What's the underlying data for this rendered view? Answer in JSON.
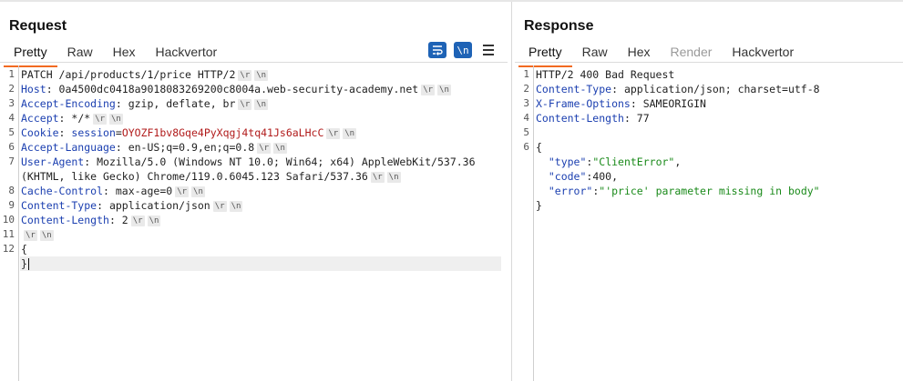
{
  "request": {
    "title": "Request",
    "tabs": [
      "Pretty",
      "Raw",
      "Hex",
      "Hackvertor"
    ],
    "tools": {
      "wrap_icon": "wrap-lines-icon",
      "newline_label": "\\n",
      "menu_icon": "hamburger-menu-icon"
    },
    "lines": [
      {
        "n": "1",
        "parts": [
          {
            "t": "PATCH /api/products/1/price HTTP/2",
            "c": ""
          }
        ],
        "crlf": true
      },
      {
        "n": "2",
        "parts": [
          {
            "t": "Host",
            "c": "hk"
          },
          {
            "t": ": 0a4500dc0418a9018083269200c8004a.web-security-academy.net",
            "c": ""
          }
        ],
        "crlf": true
      },
      {
        "n": "3",
        "parts": [
          {
            "t": "Accept-Encoding",
            "c": "hk"
          },
          {
            "t": ": gzip, deflate, br",
            "c": ""
          }
        ],
        "crlf": true
      },
      {
        "n": "4",
        "parts": [
          {
            "t": "Accept",
            "c": "hk"
          },
          {
            "t": ": */*",
            "c": ""
          }
        ],
        "crlf": true
      },
      {
        "n": "5",
        "parts": [
          {
            "t": "Cookie",
            "c": "hk"
          },
          {
            "t": ": ",
            "c": ""
          },
          {
            "t": "session",
            "c": "hk"
          },
          {
            "t": "=",
            "c": ""
          },
          {
            "t": "OYOZF1bv8Gqe4PyXqgj4tq41Js6aLHcC",
            "c": "cookie"
          }
        ],
        "crlf": true
      },
      {
        "n": "6",
        "parts": [
          {
            "t": "Accept-Language",
            "c": "hk"
          },
          {
            "t": ": en-US;q=0.9,en;q=0.8",
            "c": ""
          }
        ],
        "crlf": true
      },
      {
        "n": "7",
        "parts": [
          {
            "t": "User-Agent",
            "c": "hk"
          },
          {
            "t": ": Mozilla/5.0 (Windows NT 10.0; Win64; x64) AppleWebKit/537.36",
            "c": ""
          }
        ],
        "crlf": false
      },
      {
        "n": "",
        "parts": [
          {
            "t": "(KHTML, like Gecko) Chrome/119.0.6045.123 Safari/537.36",
            "c": ""
          }
        ],
        "crlf": true
      },
      {
        "n": "8",
        "parts": [
          {
            "t": "Cache-Control",
            "c": "hk"
          },
          {
            "t": ": max-age=0",
            "c": ""
          }
        ],
        "crlf": true
      },
      {
        "n": "9",
        "parts": [
          {
            "t": "Content-Type",
            "c": "hk"
          },
          {
            "t": ": application/json",
            "c": ""
          }
        ],
        "crlf": true
      },
      {
        "n": "10",
        "parts": [
          {
            "t": "Content-Length",
            "c": "hk"
          },
          {
            "t": ": 2",
            "c": ""
          }
        ],
        "crlf": true
      },
      {
        "n": "11",
        "parts": [],
        "crlf": true
      },
      {
        "n": "12",
        "parts": [
          {
            "t": "{",
            "c": ""
          }
        ],
        "crlf": false
      },
      {
        "n": "",
        "parts": [
          {
            "t": "}",
            "c": ""
          }
        ],
        "crlf": false,
        "caret": true,
        "highlight": true
      }
    ]
  },
  "response": {
    "title": "Response",
    "tabs": [
      "Pretty",
      "Raw",
      "Hex",
      "Render",
      "Hackvertor"
    ],
    "lines": [
      {
        "n": "1",
        "parts": [
          {
            "t": "HTTP/2 400 Bad Request",
            "c": ""
          }
        ]
      },
      {
        "n": "2",
        "parts": [
          {
            "t": "Content-Type",
            "c": "hk"
          },
          {
            "t": ": application/json; charset=utf-8",
            "c": ""
          }
        ]
      },
      {
        "n": "3",
        "parts": [
          {
            "t": "X-Frame-Options",
            "c": "hk"
          },
          {
            "t": ": SAMEORIGIN",
            "c": ""
          }
        ]
      },
      {
        "n": "4",
        "parts": [
          {
            "t": "Content-Length",
            "c": "hk"
          },
          {
            "t": ": 77",
            "c": ""
          }
        ]
      },
      {
        "n": "5",
        "parts": []
      },
      {
        "n": "6",
        "parts": [
          {
            "t": "{",
            "c": ""
          }
        ]
      },
      {
        "n": "",
        "parts": [
          {
            "t": "  ",
            "c": ""
          },
          {
            "t": "\"type\"",
            "c": "json-key"
          },
          {
            "t": ":",
            "c": ""
          },
          {
            "t": "\"ClientError\"",
            "c": "json-str"
          },
          {
            "t": ",",
            "c": ""
          }
        ]
      },
      {
        "n": "",
        "parts": [
          {
            "t": "  ",
            "c": ""
          },
          {
            "t": "\"code\"",
            "c": "json-key"
          },
          {
            "t": ":400,",
            "c": ""
          }
        ]
      },
      {
        "n": "",
        "parts": [
          {
            "t": "  ",
            "c": ""
          },
          {
            "t": "\"error\"",
            "c": "json-key"
          },
          {
            "t": ":",
            "c": ""
          },
          {
            "t": "\"'price' parameter missing in body\"",
            "c": "json-str"
          }
        ]
      },
      {
        "n": "",
        "parts": [
          {
            "t": "}",
            "c": ""
          }
        ]
      }
    ]
  },
  "crlf_tokens": [
    "\\r",
    "\\n"
  ]
}
